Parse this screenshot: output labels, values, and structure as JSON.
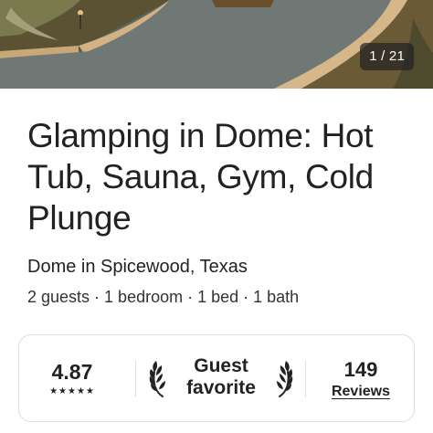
{
  "gallery": {
    "counter": "1 / 21"
  },
  "listing": {
    "title": "Glamping in Dome: Hot Tub, Sauna, Gym, Cold Plunge",
    "subtitle": "Dome in Spicewood, Texas",
    "details": "2 guests · 1 bedroom · 1 bed · 1 bath"
  },
  "rating_card": {
    "rating": "4.87",
    "stars": "★★★★★",
    "favorite_label": "Guest favorite",
    "reviews_count": "149",
    "reviews_label": "Reviews"
  }
}
